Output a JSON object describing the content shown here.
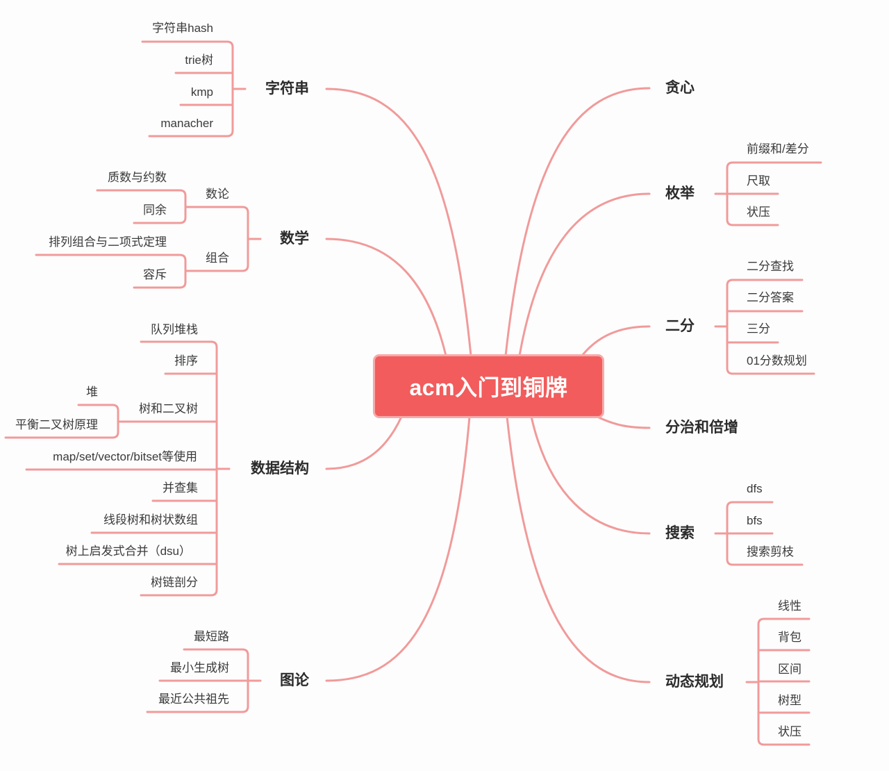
{
  "title": "acm入门到铜牌",
  "colors": {
    "line": "#f19a9a",
    "center_fill": "#f25c5c",
    "center_border": "#f7a9a9",
    "text": "#3a3a3a",
    "main_text": "#2b2b2b"
  },
  "left": [
    {
      "label": "字符串",
      "children": [
        {
          "label": "字符串hash"
        },
        {
          "label": "trie树"
        },
        {
          "label": "kmp"
        },
        {
          "label": "manacher"
        }
      ]
    },
    {
      "label": "数学",
      "children": [
        {
          "label": "数论",
          "children": [
            {
              "label": "质数与约数"
            },
            {
              "label": "同余"
            }
          ]
        },
        {
          "label": "组合",
          "children": [
            {
              "label": "排列组合与二项式定理"
            },
            {
              "label": "容斥"
            }
          ]
        }
      ]
    },
    {
      "label": "数据结构",
      "children": [
        {
          "label": "队列堆栈"
        },
        {
          "label": "排序"
        },
        {
          "label": "树和二叉树",
          "children": [
            {
              "label": "堆"
            },
            {
              "label": "平衡二叉树原理"
            }
          ]
        },
        {
          "label": "map/set/vector/bitset等使用"
        },
        {
          "label": "并查集"
        },
        {
          "label": "线段树和树状数组"
        },
        {
          "label": "树上启发式合并（dsu）"
        },
        {
          "label": "树链剖分"
        }
      ]
    },
    {
      "label": "图论",
      "children": [
        {
          "label": "最短路"
        },
        {
          "label": "最小生成树"
        },
        {
          "label": "最近公共祖先"
        }
      ]
    }
  ],
  "right": [
    {
      "label": "贪心"
    },
    {
      "label": "枚举",
      "children": [
        {
          "label": "前缀和/差分"
        },
        {
          "label": "尺取"
        },
        {
          "label": "状压"
        }
      ]
    },
    {
      "label": "二分",
      "children": [
        {
          "label": "二分查找"
        },
        {
          "label": "二分答案"
        },
        {
          "label": "三分"
        },
        {
          "label": "01分数规划"
        }
      ]
    },
    {
      "label": "分治和倍增"
    },
    {
      "label": "搜索",
      "children": [
        {
          "label": "dfs"
        },
        {
          "label": "bfs"
        },
        {
          "label": "搜索剪枝"
        }
      ]
    },
    {
      "label": "动态规划",
      "children": [
        {
          "label": "线性"
        },
        {
          "label": "背包"
        },
        {
          "label": "区间"
        },
        {
          "label": "树型"
        },
        {
          "label": "状压"
        }
      ]
    }
  ]
}
